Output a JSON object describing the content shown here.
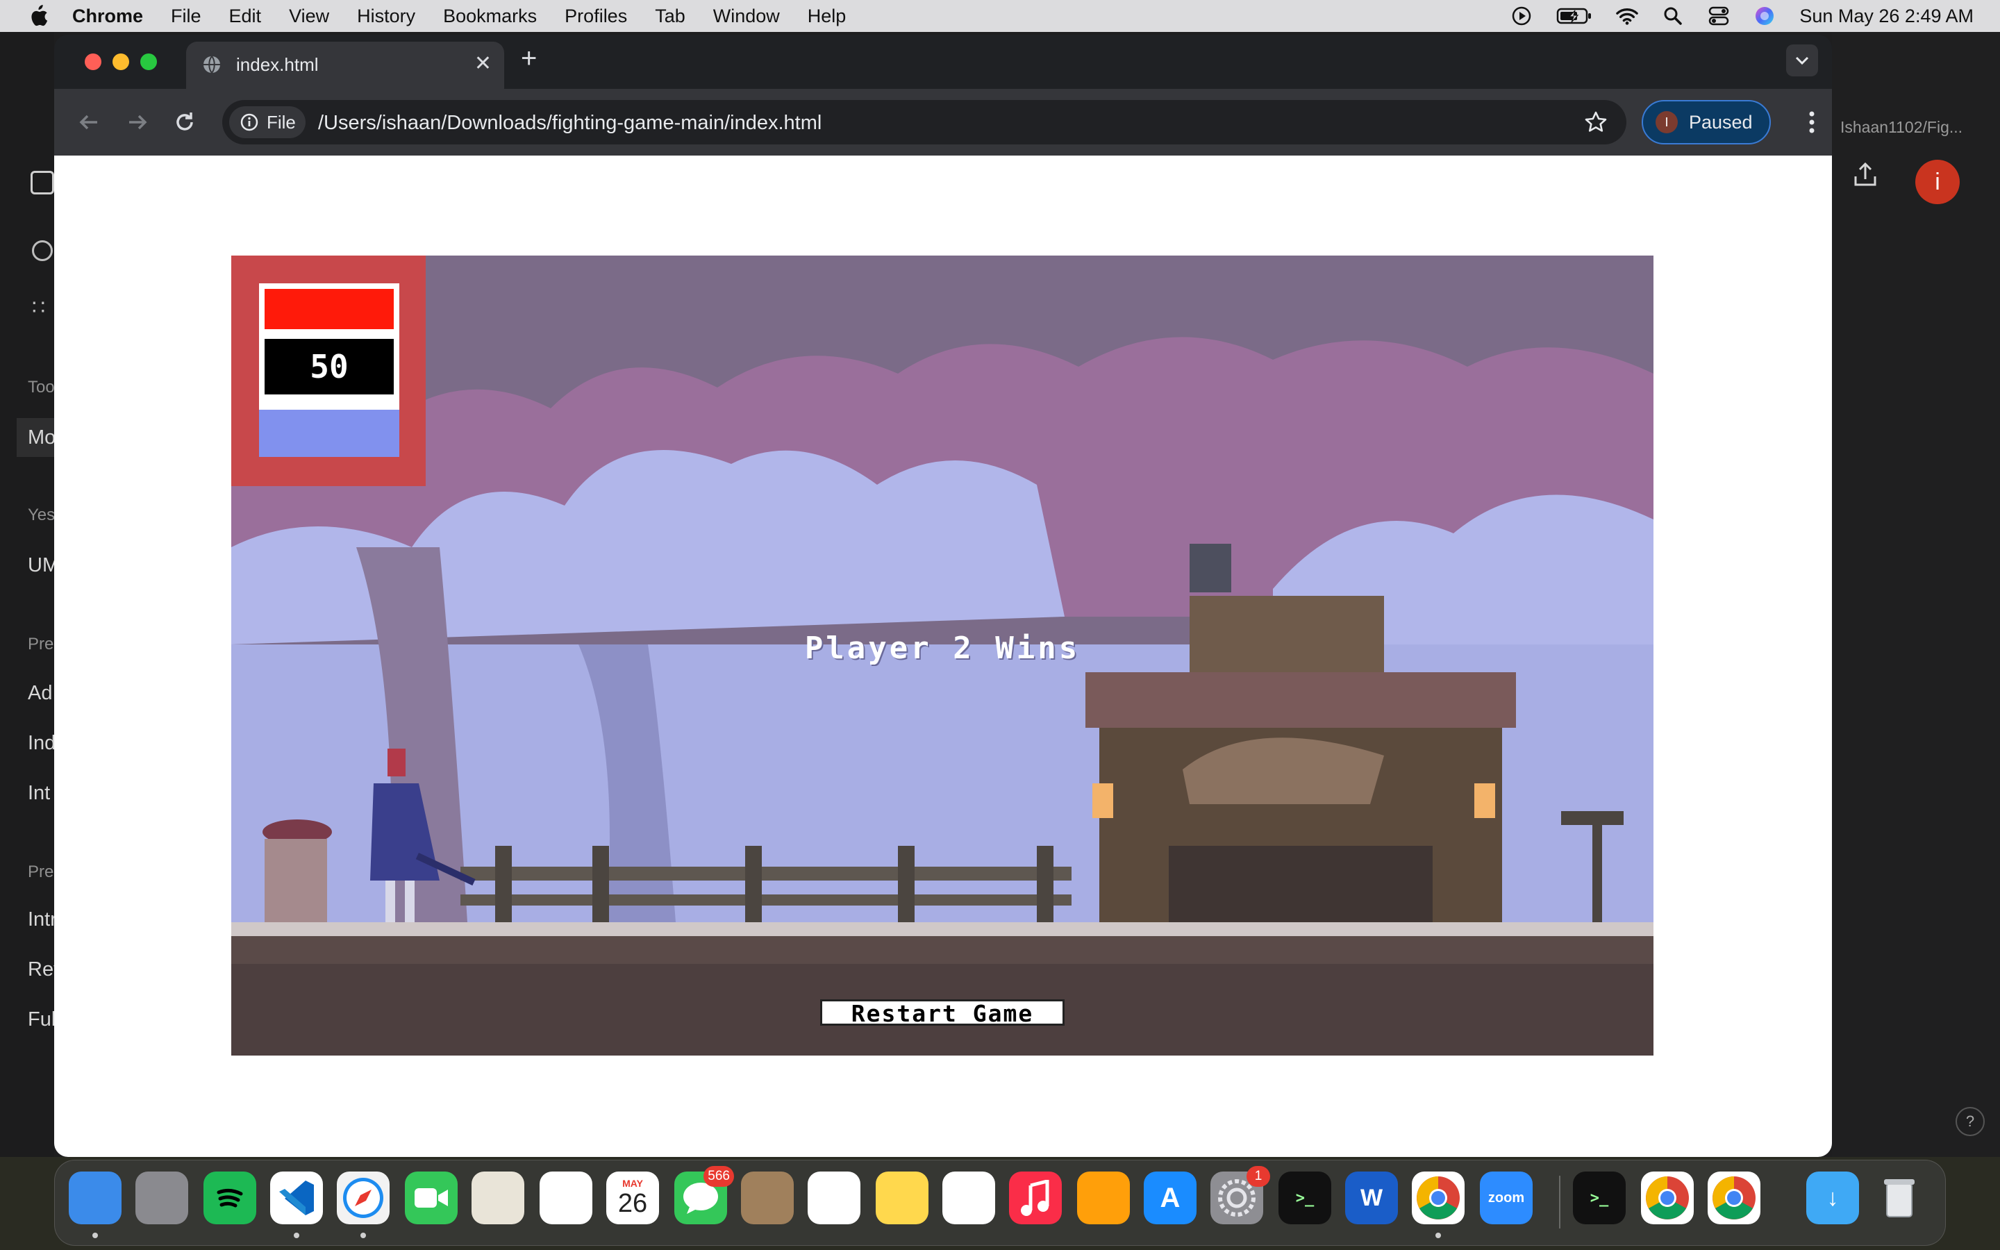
{
  "menubar": {
    "app_name": "Chrome",
    "menus": [
      "File",
      "Edit",
      "View",
      "History",
      "Bookmarks",
      "Profiles",
      "Tab",
      "Window",
      "Help"
    ],
    "clock": "Sun May 26  2:49 AM"
  },
  "background_app": {
    "sidebar_fragments": [
      "Too",
      "Mo",
      "Yes",
      "UM",
      "Pre",
      "Ad",
      "Ind",
      "Int",
      "Pre",
      "Intr",
      "Rev",
      "Ful"
    ],
    "tab_fragment": "Ishaan1102/Fig...",
    "avatar_letter": "i"
  },
  "browser": {
    "tab_title": "index.html",
    "chip_label": "File",
    "url": "/Users/ishaan/Downloads/fighting-game-main/index.html",
    "profile_letter": "I",
    "profile_status": "Paused"
  },
  "game": {
    "timer": "50",
    "result_text": "Player 2 Wins",
    "restart_label": "Restart Game",
    "player1_health": 1.0,
    "player2_health": 1.0,
    "colors": {
      "hud_frame": "#c8484b",
      "player1_bar": "#ff1a0a",
      "player2_bar": "#8191ee"
    }
  },
  "dock": {
    "apps": [
      "Finder",
      "Launchpad",
      "Spotify",
      "Visual Studio Code",
      "Safari",
      "FaceTime",
      "Maps",
      "Photos",
      "Calendar",
      "Messages",
      "Contacts",
      "Reminders",
      "Notes",
      "Freeform",
      "Music",
      "Pages",
      "App Store",
      "System Settings",
      "Terminal",
      "Microsoft Word",
      "Google Chrome",
      "Zoom",
      "Terminal",
      "Google Chrome",
      "Google Chrome",
      "Downloads",
      "Trash"
    ],
    "calendar_month": "MAY",
    "calendar_day": "26",
    "messages_badge": "566",
    "settings_badge": "1",
    "zoom_label": "zoom"
  }
}
